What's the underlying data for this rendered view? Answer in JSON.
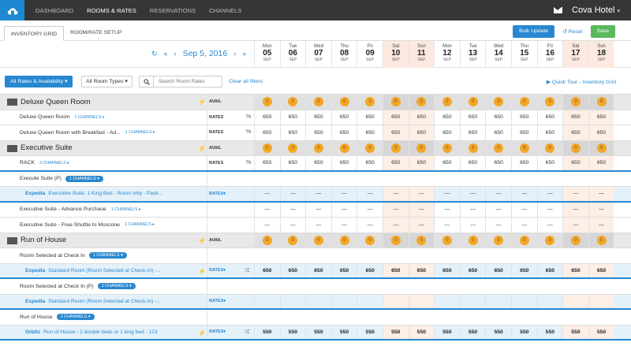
{
  "nav": {
    "items": [
      "DASHBOARD",
      "ROOMS & RATES",
      "RESERVATIONS",
      "CHANNELS"
    ],
    "active": 1,
    "hotel": "Cova Hotel"
  },
  "tabs": [
    "INVENTORY GRID",
    "ROOM/RATE SETUP"
  ],
  "actions": {
    "bulk": "Bulk Update",
    "reset": "Reset",
    "save": "Save"
  },
  "date": {
    "label": "Sep 5, 2016"
  },
  "days": [
    {
      "wd": "Mon",
      "d": "05",
      "m": "SEP",
      "we": false
    },
    {
      "wd": "Tue",
      "d": "06",
      "m": "SEP",
      "we": false
    },
    {
      "wd": "Wed",
      "d": "07",
      "m": "SEP",
      "we": false
    },
    {
      "wd": "Thu",
      "d": "08",
      "m": "SEP",
      "we": false
    },
    {
      "wd": "Fri",
      "d": "09",
      "m": "SEP",
      "we": false
    },
    {
      "wd": "Sat",
      "d": "10",
      "m": "SEP",
      "we": true
    },
    {
      "wd": "Sun",
      "d": "11",
      "m": "SEP",
      "we": true
    },
    {
      "wd": "Mon",
      "d": "12",
      "m": "SEP",
      "we": false
    },
    {
      "wd": "Tue",
      "d": "13",
      "m": "SEP",
      "we": false
    },
    {
      "wd": "Wed",
      "d": "14",
      "m": "SEP",
      "we": false
    },
    {
      "wd": "Thu",
      "d": "15",
      "m": "SEP",
      "we": false
    },
    {
      "wd": "Fri",
      "d": "16",
      "m": "SEP",
      "we": false
    },
    {
      "wd": "Sat",
      "d": "17",
      "m": "SEP",
      "we": true
    },
    {
      "wd": "Sun",
      "d": "18",
      "m": "SEP",
      "we": true
    }
  ],
  "filters": {
    "all": "All Rates & Availability",
    "roomtypes": "All Room Types",
    "search_placeholder": "Search Room Rates",
    "clear": "Clear all filters",
    "tour": "Quick Tour - Inventory Grid"
  },
  "rows": [
    {
      "kind": "grp",
      "label": "Deluxe Queen Room",
      "type": "AVAIL",
      "cell": "0"
    },
    {
      "kind": "rate",
      "label": "Deluxe Queen Room",
      "ch": "1 CHANNELS",
      "type": "RATES",
      "cell": "650",
      "pct": true
    },
    {
      "kind": "rate",
      "label": "Deluxe Queen Room with Breakfast - Ad...",
      "ch": "1 CHANNELS",
      "type": "RATES",
      "cell": "650",
      "pct": true
    },
    {
      "kind": "grp",
      "label": "Executive Suite",
      "type": "AVAIL",
      "cell": "0"
    },
    {
      "kind": "rate",
      "label": "RACK",
      "ch": "3 CHANNELS",
      "type": "RATES",
      "cell": "650",
      "pct": true,
      "sep": true
    },
    {
      "kind": "pillrow",
      "label": "Execute Suite (P)",
      "pill": "1 CHANNELS"
    },
    {
      "kind": "exp",
      "src": "Expedia",
      "label": "Executive Suite, 1 King Bed - Room only - Pack...",
      "type": "RATES",
      "cell": "—",
      "sep": true
    },
    {
      "kind": "rate",
      "label": "Executive Suite - Advance Purchase",
      "ch": "1 CHANNELS",
      "type": "",
      "cell": "—"
    },
    {
      "kind": "rate",
      "label": "Executive Suite - Free Shuttle to Moscone",
      "ch": "1 CHANNELS",
      "type": "",
      "cell": "—"
    },
    {
      "kind": "grp",
      "label": "Run of House",
      "type": "AVAIL",
      "cell": "0"
    },
    {
      "kind": "pillrow",
      "label": "Room Selected at Check In",
      "pill": "1 CHANNELS"
    },
    {
      "kind": "exp",
      "src": "Expedia",
      "label": "Standard Room (Room Selected at Check-In) -...",
      "type": "RATES",
      "cell": "650",
      "bold": true,
      "bolt": true,
      "shuffle": true,
      "sep": true
    },
    {
      "kind": "pillrow",
      "label": "Room Selected at Check In (P)",
      "pill": "1 CHANNELS"
    },
    {
      "kind": "exp",
      "src": "Expedia",
      "label": "Standard Room (Room Selected at Check-In) -...",
      "type": "RATES",
      "cell": "",
      "sep": true
    },
    {
      "kind": "pillrow",
      "label": "Run of House",
      "pill": "1 CHANNELS"
    },
    {
      "kind": "exp",
      "src": "Orbitz",
      "label": "Run of House - 2 double beds or 1 king bed - 123",
      "type": "RATES",
      "cell": "550",
      "bold": true,
      "bolt": true,
      "shuffle": true,
      "sep": true
    }
  ]
}
